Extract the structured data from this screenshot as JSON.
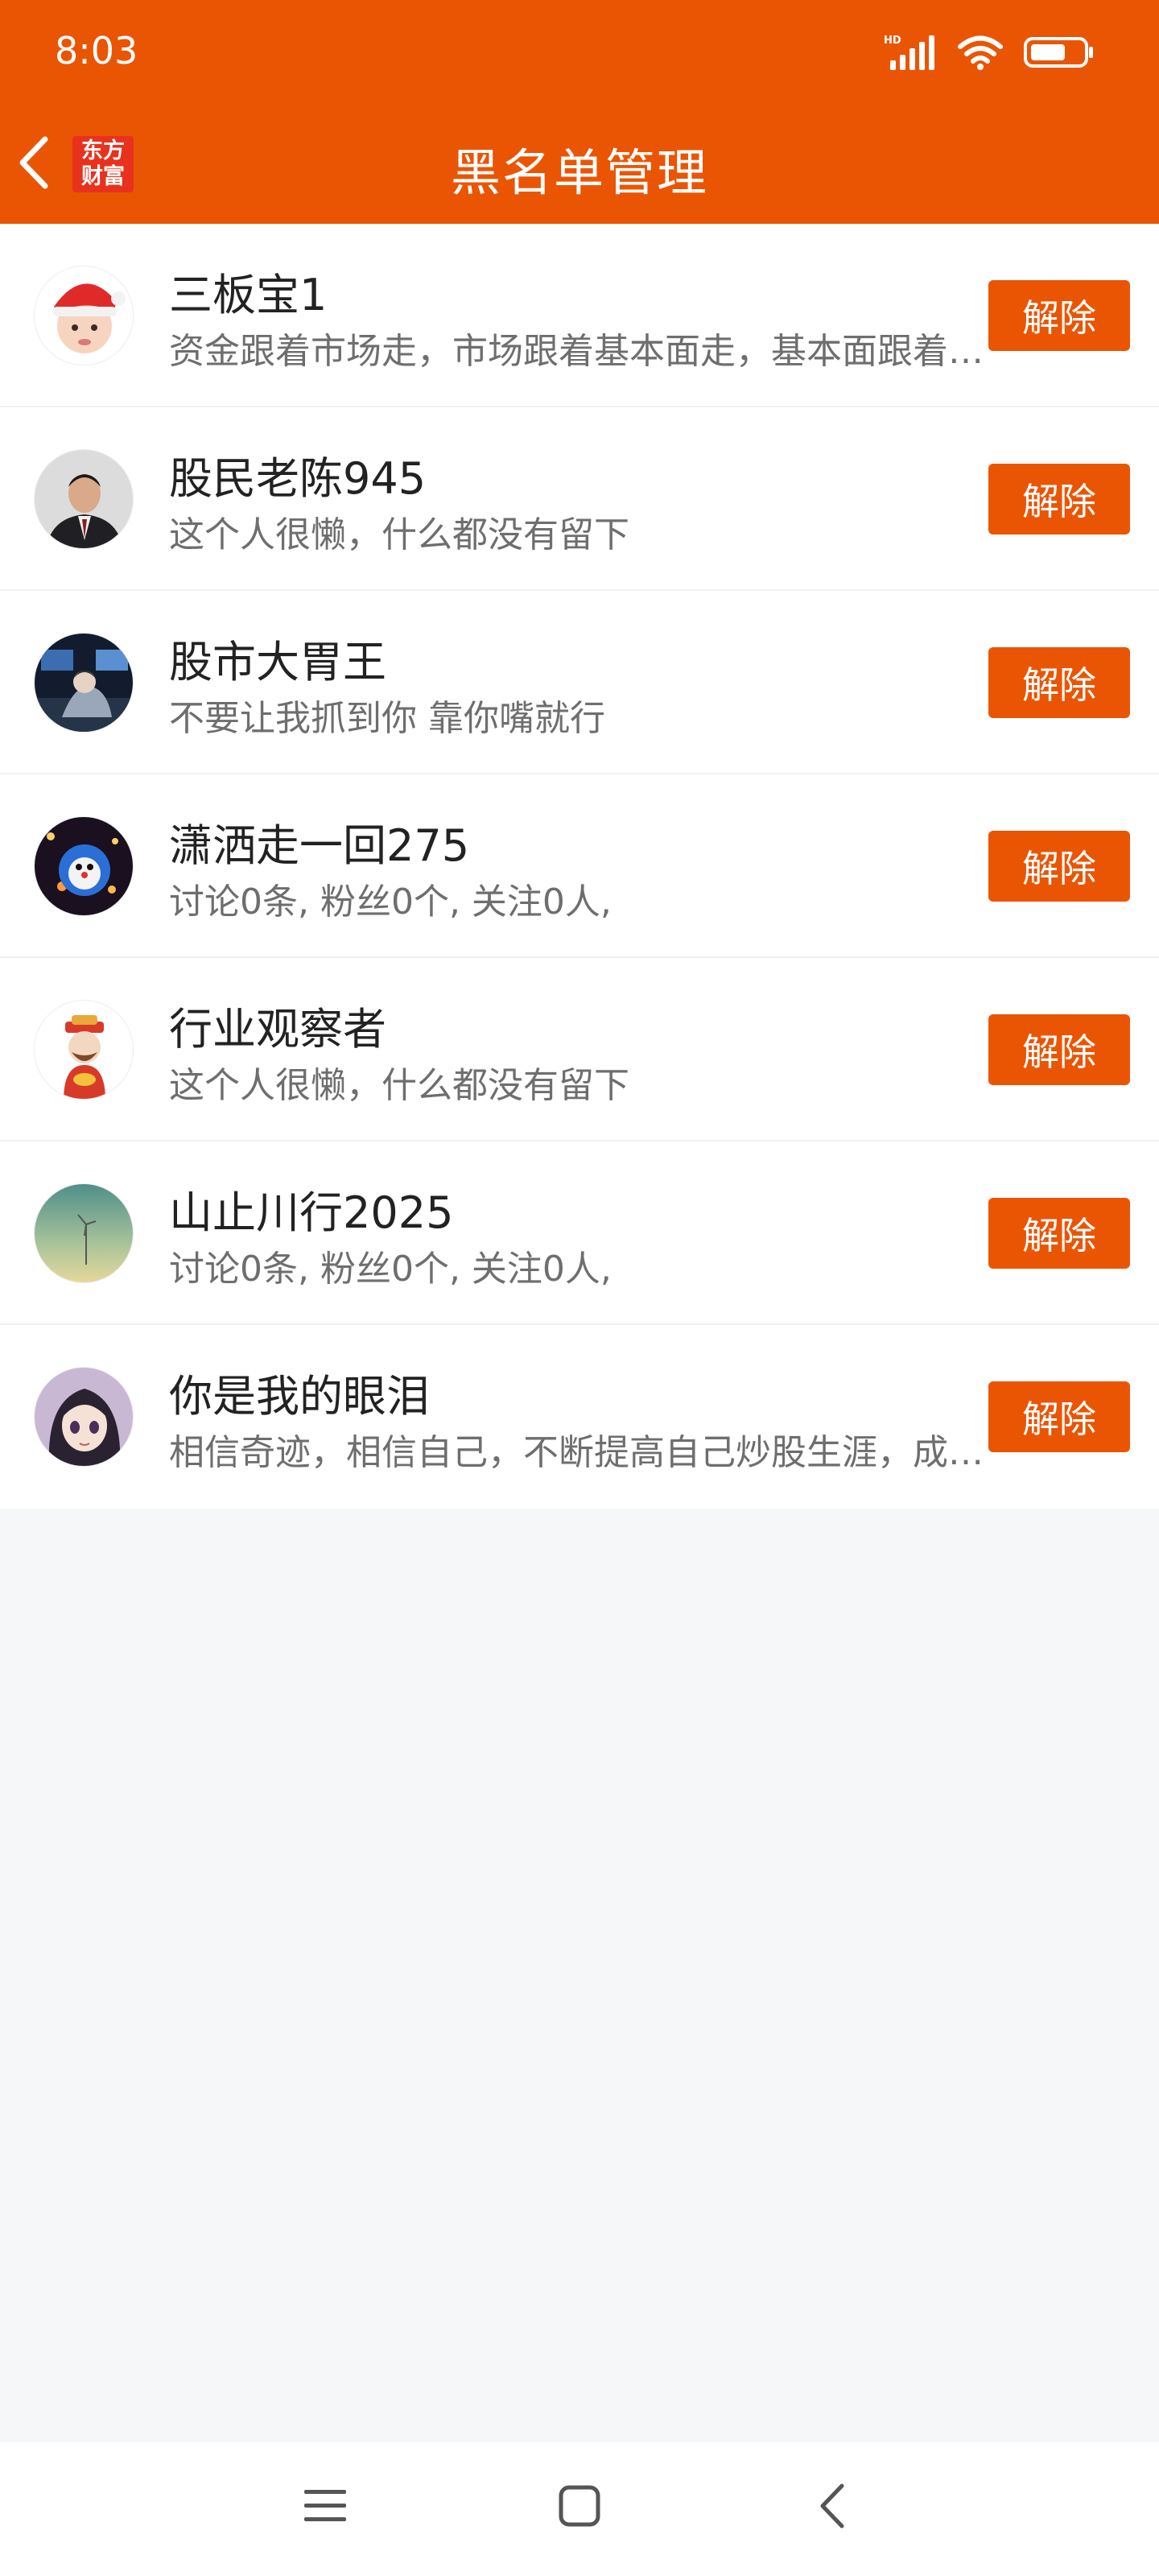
{
  "status_bar": {
    "time": "8:03",
    "icons": [
      "hd-signal-icon",
      "wifi-icon",
      "battery-icon"
    ]
  },
  "header": {
    "title": "黑名单管理",
    "logo_line1": "东方",
    "logo_line2": "财富"
  },
  "list": [
    {
      "name": "三板宝1",
      "desc": "资金跟着市场走，市场跟着基本面走，基本面跟着政策走",
      "button": "解除",
      "avatar": "santa-baby-avatar"
    },
    {
      "name": "股民老陈945",
      "desc": "这个人很懒，什么都没有留下",
      "button": "解除",
      "avatar": "man-in-suit-avatar"
    },
    {
      "name": "股市大胃王",
      "desc": "不要让我抓到你 靠你嘴就行",
      "button": "解除",
      "avatar": "person-at-computer-avatar"
    },
    {
      "name": "潇洒走一回275",
      "desc": "讨论0条, 粉丝0个, 关注0人,",
      "button": "解除",
      "avatar": "space-scene-avatar"
    },
    {
      "name": "行业观察者",
      "desc": "这个人很懒，什么都没有留下",
      "button": "解除",
      "avatar": "fortune-god-avatar"
    },
    {
      "name": "山止川行2025",
      "desc": "讨论0条, 粉丝0个, 关注0人,",
      "button": "解除",
      "avatar": "landscape-windmill-avatar"
    },
    {
      "name": "你是我的眼泪",
      "desc": "相信奇迹，相信自己，不断提高自己炒股生涯，成就梦想",
      "button": "解除",
      "avatar": "anime-girl-avatar"
    }
  ],
  "colors": {
    "accent": "#ea5504",
    "background": "#f6f7f9"
  },
  "system_nav": [
    "menu-icon",
    "home-icon",
    "back-icon"
  ]
}
